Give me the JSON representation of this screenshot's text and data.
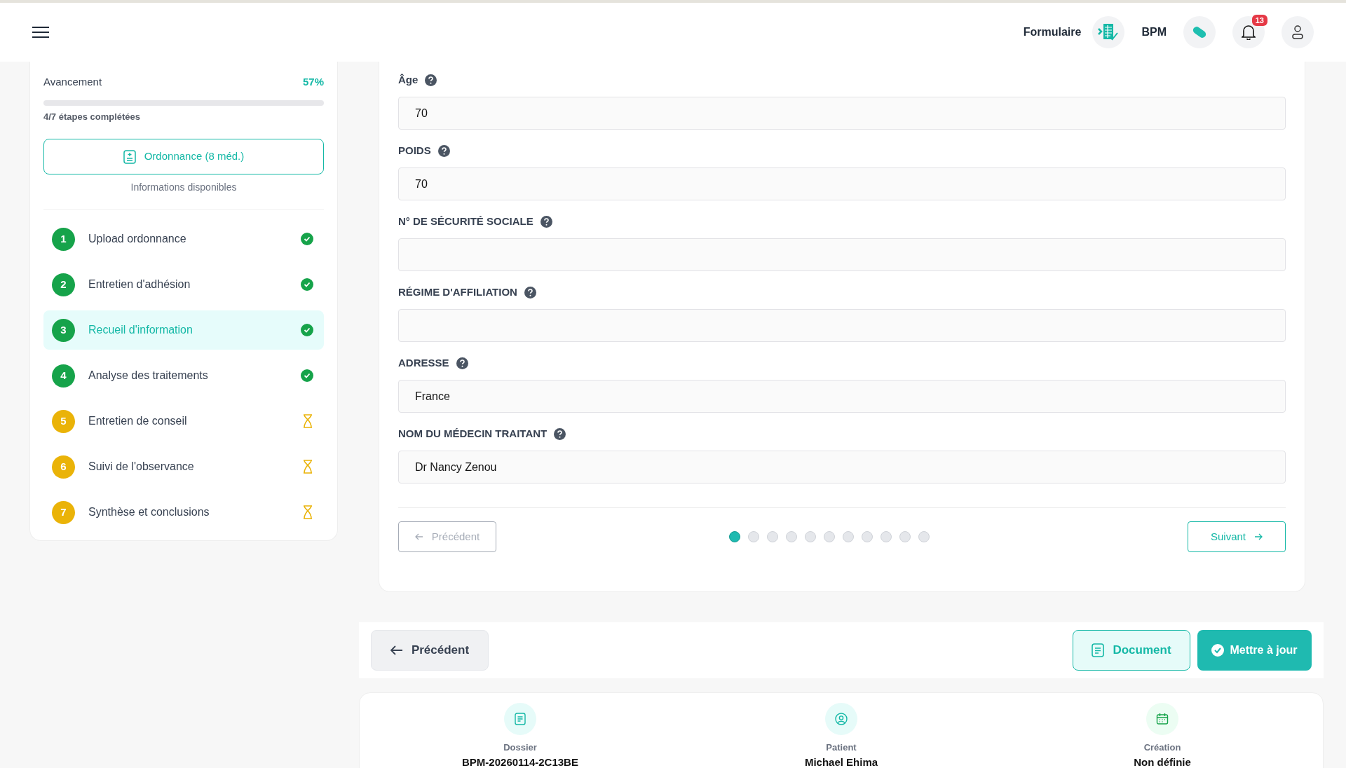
{
  "header": {
    "label": "Formulaire",
    "brand": "BPM",
    "notifications": "13"
  },
  "progress": {
    "label": "Avancement",
    "percent": "57%",
    "level": 0,
    "caption": "4/7 étapes complétées"
  },
  "prescription_button": "Ordonnance (8 méd.)",
  "info_caption": "Informations disponibles",
  "steps": [
    {
      "number": "1",
      "label": "Upload ordonnance",
      "kind": "done",
      "selected": false
    },
    {
      "number": "2",
      "label": "Entretien d'adhésion",
      "kind": "done",
      "selected": false
    },
    {
      "number": "3",
      "label": "Recueil d'information",
      "kind": "done",
      "selected": true
    },
    {
      "number": "4",
      "label": "Analyse des traitements",
      "kind": "done",
      "selected": false
    },
    {
      "number": "5",
      "label": "Entretien de conseil",
      "kind": "pending",
      "selected": false
    },
    {
      "number": "6",
      "label": "Suivi de l'observance",
      "kind": "pending",
      "selected": false
    },
    {
      "number": "7",
      "label": "Synthèse et conclusions",
      "kind": "pending",
      "selected": false
    }
  ],
  "fields": [
    {
      "label": "Âge",
      "value": "70"
    },
    {
      "label": "POIDS",
      "value": "70"
    },
    {
      "label": "N° DE SÉCURITÉ SOCIALE"
    },
    {
      "label": "RÉGIME D'AFFILIATION"
    },
    {
      "label": "ADRESSE",
      "value": "France"
    },
    {
      "label": "NOM DU MÉDECIN TRAITANT",
      "value": "Dr Nancy Zenou"
    }
  ],
  "pager": {
    "previous": "Précédent",
    "next": "Suivant",
    "previous_disabled": true,
    "dots": [
      {
        "selected": true
      },
      {
        "selected": false
      },
      {
        "selected": false
      },
      {
        "selected": false
      },
      {
        "selected": false
      },
      {
        "selected": false
      },
      {
        "selected": false
      },
      {
        "selected": false
      },
      {
        "selected": false
      },
      {
        "selected": false
      },
      {
        "selected": false
      }
    ]
  },
  "actions": {
    "previous": "Précédent",
    "document": "Document",
    "update": "Mettre à jour"
  },
  "summary": [
    {
      "kind": "file",
      "label": "Dossier",
      "value": "BPM-20260114-2C13BE"
    },
    {
      "kind": "person",
      "label": "Patient",
      "value": "Michael Ehima"
    },
    {
      "kind": "calendar",
      "label": "Création",
      "value": "Non définie"
    }
  ]
}
